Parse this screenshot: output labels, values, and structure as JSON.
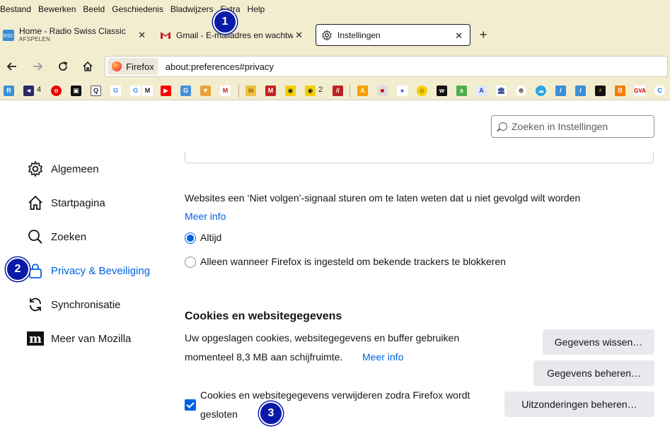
{
  "menubar": {
    "items": [
      "Bestand",
      "Bewerken",
      "Beeld",
      "Geschiedenis",
      "Bladwijzers",
      "Extra",
      "Help"
    ]
  },
  "tabs": [
    {
      "title": "Home - Radio Swiss Classic",
      "subtitle": "AFSPELEN",
      "icon": "radio-swiss-icon",
      "active": false
    },
    {
      "title": "Gmail - E-mailadres en wachtwoord",
      "icon": "gmail-icon",
      "active": false
    },
    {
      "title": "Instellingen",
      "icon": "gear-icon",
      "active": true
    }
  ],
  "navbar": {
    "identity_label": "Firefox",
    "url": "about:preferences#privacy"
  },
  "bookmarks": {
    "badge_1": "4",
    "badge_2": "2"
  },
  "search": {
    "placeholder": "Zoeken in Instellingen"
  },
  "sidebar": {
    "items": [
      {
        "label": "Algemeen",
        "icon": "gear-icon"
      },
      {
        "label": "Startpagina",
        "icon": "home-icon"
      },
      {
        "label": "Zoeken",
        "icon": "search-icon"
      },
      {
        "label": "Privacy & Beveiliging",
        "icon": "lock-icon",
        "selected": true
      },
      {
        "label": "Synchronisatie",
        "icon": "sync-icon"
      },
      {
        "label": "Meer van Mozilla",
        "icon": "mozilla-icon"
      }
    ]
  },
  "dnt": {
    "text": "Websites een ‘Niet volgen’-signaal sturen om te laten weten dat u niet gevolgd wilt worden",
    "link": "Meer info",
    "option_always": "Altijd",
    "option_only": "Alleen wanneer Firefox is ingesteld om bekende trackers te blokkeren",
    "selected": "always"
  },
  "cookies": {
    "title": "Cookies en websitegegevens",
    "desc_line1": "Uw opgeslagen cookies, websitegegevens en buffer gebruiken",
    "desc_line2": "momenteel 8,3 MB aan schijfruimte.",
    "link": "Meer info",
    "btn_clear": "Gegevens wissen…",
    "btn_manage": "Gegevens beheren…",
    "btn_exceptions": "Uitzonderingen beheren…",
    "checkbox_line1": "Cookies en websitegegevens verwijderen zodra Firefox wordt",
    "checkbox_line2": "gesloten",
    "checkbox_checked": true
  },
  "markers": [
    "1",
    "2",
    "3"
  ],
  "colors": {
    "chrome_bg": "#f3edd0",
    "accent": "#0061e0",
    "marker": "#0a1aa8"
  }
}
